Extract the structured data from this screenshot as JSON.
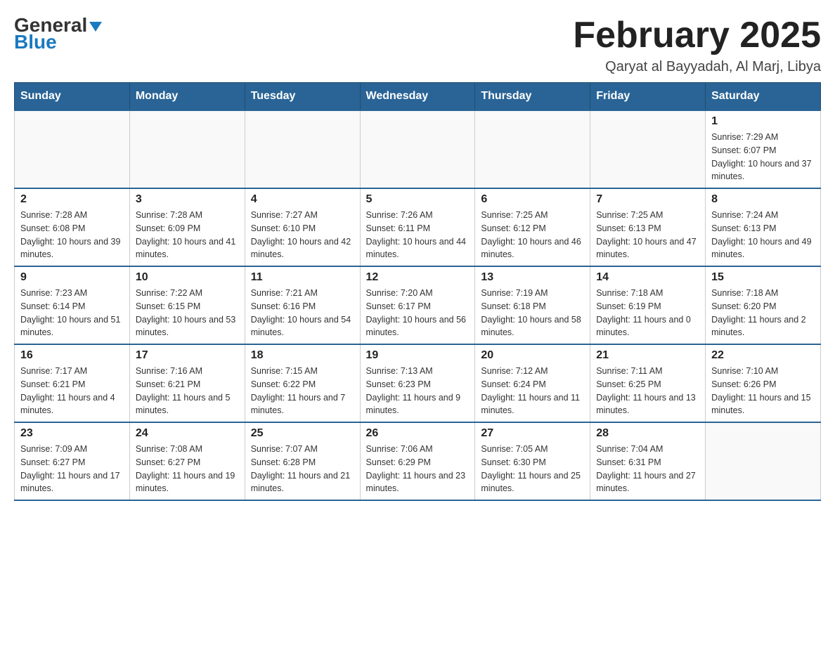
{
  "header": {
    "logo_general": "General",
    "logo_blue": "Blue",
    "month_title": "February 2025",
    "location": "Qaryat al Bayyadah, Al Marj, Libya"
  },
  "days_of_week": [
    "Sunday",
    "Monday",
    "Tuesday",
    "Wednesday",
    "Thursday",
    "Friday",
    "Saturday"
  ],
  "weeks": [
    [
      {
        "day": "",
        "sunrise": "",
        "sunset": "",
        "daylight": ""
      },
      {
        "day": "",
        "sunrise": "",
        "sunset": "",
        "daylight": ""
      },
      {
        "day": "",
        "sunrise": "",
        "sunset": "",
        "daylight": ""
      },
      {
        "day": "",
        "sunrise": "",
        "sunset": "",
        "daylight": ""
      },
      {
        "day": "",
        "sunrise": "",
        "sunset": "",
        "daylight": ""
      },
      {
        "day": "",
        "sunrise": "",
        "sunset": "",
        "daylight": ""
      },
      {
        "day": "1",
        "sunrise": "Sunrise: 7:29 AM",
        "sunset": "Sunset: 6:07 PM",
        "daylight": "Daylight: 10 hours and 37 minutes."
      }
    ],
    [
      {
        "day": "2",
        "sunrise": "Sunrise: 7:28 AM",
        "sunset": "Sunset: 6:08 PM",
        "daylight": "Daylight: 10 hours and 39 minutes."
      },
      {
        "day": "3",
        "sunrise": "Sunrise: 7:28 AM",
        "sunset": "Sunset: 6:09 PM",
        "daylight": "Daylight: 10 hours and 41 minutes."
      },
      {
        "day": "4",
        "sunrise": "Sunrise: 7:27 AM",
        "sunset": "Sunset: 6:10 PM",
        "daylight": "Daylight: 10 hours and 42 minutes."
      },
      {
        "day": "5",
        "sunrise": "Sunrise: 7:26 AM",
        "sunset": "Sunset: 6:11 PM",
        "daylight": "Daylight: 10 hours and 44 minutes."
      },
      {
        "day": "6",
        "sunrise": "Sunrise: 7:25 AM",
        "sunset": "Sunset: 6:12 PM",
        "daylight": "Daylight: 10 hours and 46 minutes."
      },
      {
        "day": "7",
        "sunrise": "Sunrise: 7:25 AM",
        "sunset": "Sunset: 6:13 PM",
        "daylight": "Daylight: 10 hours and 47 minutes."
      },
      {
        "day": "8",
        "sunrise": "Sunrise: 7:24 AM",
        "sunset": "Sunset: 6:13 PM",
        "daylight": "Daylight: 10 hours and 49 minutes."
      }
    ],
    [
      {
        "day": "9",
        "sunrise": "Sunrise: 7:23 AM",
        "sunset": "Sunset: 6:14 PM",
        "daylight": "Daylight: 10 hours and 51 minutes."
      },
      {
        "day": "10",
        "sunrise": "Sunrise: 7:22 AM",
        "sunset": "Sunset: 6:15 PM",
        "daylight": "Daylight: 10 hours and 53 minutes."
      },
      {
        "day": "11",
        "sunrise": "Sunrise: 7:21 AM",
        "sunset": "Sunset: 6:16 PM",
        "daylight": "Daylight: 10 hours and 54 minutes."
      },
      {
        "day": "12",
        "sunrise": "Sunrise: 7:20 AM",
        "sunset": "Sunset: 6:17 PM",
        "daylight": "Daylight: 10 hours and 56 minutes."
      },
      {
        "day": "13",
        "sunrise": "Sunrise: 7:19 AM",
        "sunset": "Sunset: 6:18 PM",
        "daylight": "Daylight: 10 hours and 58 minutes."
      },
      {
        "day": "14",
        "sunrise": "Sunrise: 7:18 AM",
        "sunset": "Sunset: 6:19 PM",
        "daylight": "Daylight: 11 hours and 0 minutes."
      },
      {
        "day": "15",
        "sunrise": "Sunrise: 7:18 AM",
        "sunset": "Sunset: 6:20 PM",
        "daylight": "Daylight: 11 hours and 2 minutes."
      }
    ],
    [
      {
        "day": "16",
        "sunrise": "Sunrise: 7:17 AM",
        "sunset": "Sunset: 6:21 PM",
        "daylight": "Daylight: 11 hours and 4 minutes."
      },
      {
        "day": "17",
        "sunrise": "Sunrise: 7:16 AM",
        "sunset": "Sunset: 6:21 PM",
        "daylight": "Daylight: 11 hours and 5 minutes."
      },
      {
        "day": "18",
        "sunrise": "Sunrise: 7:15 AM",
        "sunset": "Sunset: 6:22 PM",
        "daylight": "Daylight: 11 hours and 7 minutes."
      },
      {
        "day": "19",
        "sunrise": "Sunrise: 7:13 AM",
        "sunset": "Sunset: 6:23 PM",
        "daylight": "Daylight: 11 hours and 9 minutes."
      },
      {
        "day": "20",
        "sunrise": "Sunrise: 7:12 AM",
        "sunset": "Sunset: 6:24 PM",
        "daylight": "Daylight: 11 hours and 11 minutes."
      },
      {
        "day": "21",
        "sunrise": "Sunrise: 7:11 AM",
        "sunset": "Sunset: 6:25 PM",
        "daylight": "Daylight: 11 hours and 13 minutes."
      },
      {
        "day": "22",
        "sunrise": "Sunrise: 7:10 AM",
        "sunset": "Sunset: 6:26 PM",
        "daylight": "Daylight: 11 hours and 15 minutes."
      }
    ],
    [
      {
        "day": "23",
        "sunrise": "Sunrise: 7:09 AM",
        "sunset": "Sunset: 6:27 PM",
        "daylight": "Daylight: 11 hours and 17 minutes."
      },
      {
        "day": "24",
        "sunrise": "Sunrise: 7:08 AM",
        "sunset": "Sunset: 6:27 PM",
        "daylight": "Daylight: 11 hours and 19 minutes."
      },
      {
        "day": "25",
        "sunrise": "Sunrise: 7:07 AM",
        "sunset": "Sunset: 6:28 PM",
        "daylight": "Daylight: 11 hours and 21 minutes."
      },
      {
        "day": "26",
        "sunrise": "Sunrise: 7:06 AM",
        "sunset": "Sunset: 6:29 PM",
        "daylight": "Daylight: 11 hours and 23 minutes."
      },
      {
        "day": "27",
        "sunrise": "Sunrise: 7:05 AM",
        "sunset": "Sunset: 6:30 PM",
        "daylight": "Daylight: 11 hours and 25 minutes."
      },
      {
        "day": "28",
        "sunrise": "Sunrise: 7:04 AM",
        "sunset": "Sunset: 6:31 PM",
        "daylight": "Daylight: 11 hours and 27 minutes."
      },
      {
        "day": "",
        "sunrise": "",
        "sunset": "",
        "daylight": ""
      }
    ]
  ]
}
